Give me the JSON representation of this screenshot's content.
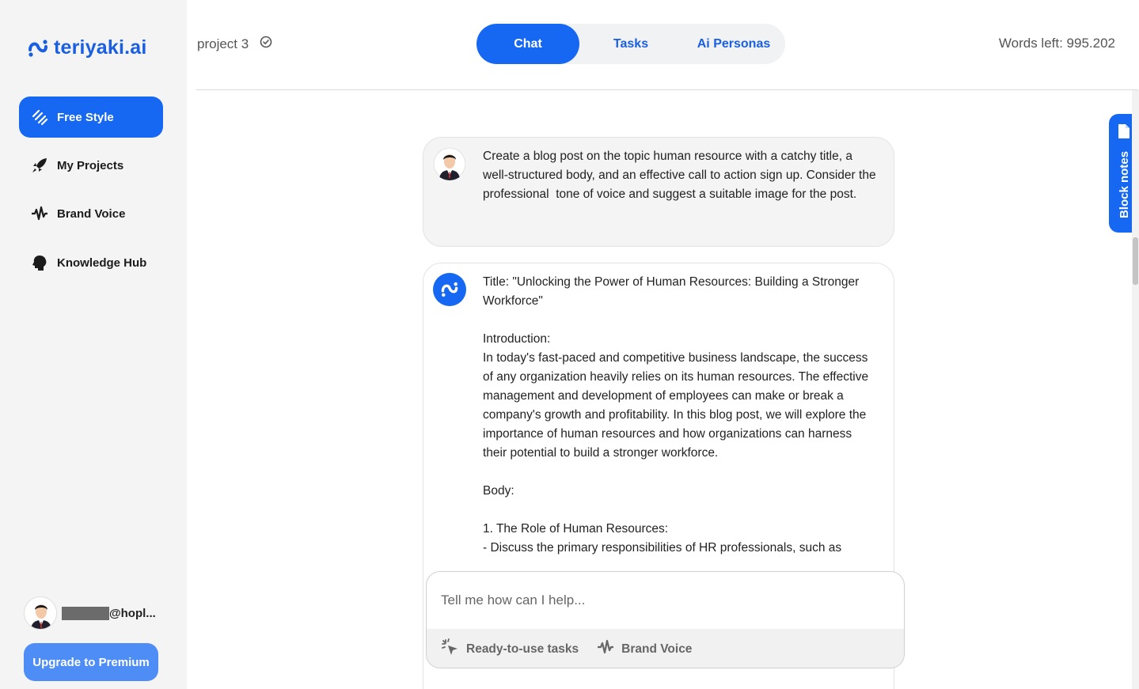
{
  "brand": {
    "name": "teriyaki.ai",
    "color": "#1a5fe0"
  },
  "sidebar": {
    "items": [
      {
        "label": "Free Style",
        "icon": "free-style-icon",
        "active": true
      },
      {
        "label": "My Projects",
        "icon": "rocket-icon",
        "active": false
      },
      {
        "label": "Brand Voice",
        "icon": "waveform-icon",
        "active": false
      },
      {
        "label": "Knowledge Hub",
        "icon": "head-icon",
        "active": false
      }
    ],
    "user": {
      "email_suffix": "@hopl..."
    },
    "upgrade_label": "Upgrade to Premium"
  },
  "header": {
    "project_name": "project 3",
    "tabs": [
      {
        "label": "Chat",
        "active": true
      },
      {
        "label": "Tasks",
        "active": false
      },
      {
        "label": "Ai Personas",
        "active": false
      }
    ],
    "words_left": "Words left: 995.202"
  },
  "chat": {
    "user_message": "Create a blog post on the topic human resource with a catchy title, a well-structured body, and an effective call to action sign up. Consider the professional  tone of voice and suggest a suitable image for the post.",
    "bot_message": {
      "title": "Title: \"Unlocking the Power of Human Resources: Building a Stronger Workforce\"",
      "intro_heading": "Introduction:",
      "intro_text": "In today's fast-paced and competitive business landscape, the success of any organization heavily relies on its human resources. The effective management and development of employees can make or break a company's growth and profitability. In this blog post, we will explore the importance of human resources and how organizations can harness their potential to build a stronger workforce.",
      "body_heading": "Body:",
      "section_1": "1. The Role of Human Resources:",
      "bullet_1": "- Discuss the primary responsibilities of HR professionals, such as"
    }
  },
  "composer": {
    "placeholder": "Tell me how can I help...",
    "tools": [
      {
        "label": "Ready-to-use tasks",
        "icon": "sparkle-cursor-icon"
      },
      {
        "label": "Brand Voice",
        "icon": "waveform-icon"
      }
    ]
  },
  "block_notes": {
    "label": "Block notes",
    "icon": "document-icon"
  },
  "colors": {
    "accent": "#1668f2",
    "sidebar_bg": "#f4f4f5",
    "upgrade_bg": "#4d8df5"
  }
}
